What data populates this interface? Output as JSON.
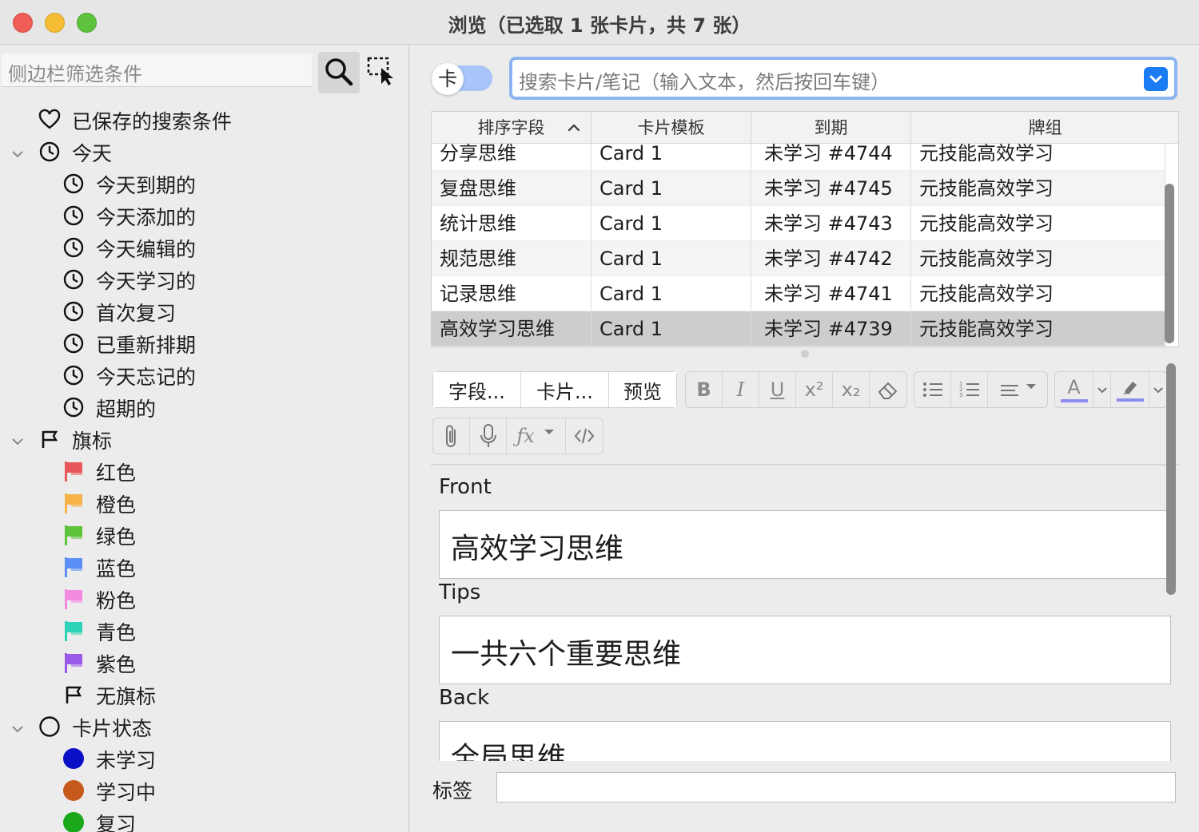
{
  "window": {
    "title": "浏览（已选取 1 张卡片，共 7 张）"
  },
  "sidebar": {
    "filter_placeholder": "侧边栏筛选条件",
    "items": [
      {
        "label": "已保存的搜索条件",
        "icon": "heart-icon",
        "level": 0,
        "expandable": false
      },
      {
        "label": "今天",
        "icon": "clock-icon",
        "level": 0,
        "expandable": true
      },
      {
        "label": "今天到期的",
        "icon": "clock-icon",
        "level": 1
      },
      {
        "label": "今天添加的",
        "icon": "clock-icon",
        "level": 1
      },
      {
        "label": "今天编辑的",
        "icon": "clock-icon",
        "level": 1
      },
      {
        "label": "今天学习的",
        "icon": "clock-icon",
        "level": 1
      },
      {
        "label": "首次复习",
        "icon": "clock-icon",
        "level": 1
      },
      {
        "label": "已重新排期",
        "icon": "clock-icon",
        "level": 1
      },
      {
        "label": "今天忘记的",
        "icon": "clock-icon",
        "level": 1
      },
      {
        "label": "超期的",
        "icon": "clock-icon",
        "level": 1
      },
      {
        "label": "旗标",
        "icon": "flag-outline-icon",
        "level": 0,
        "expandable": true
      },
      {
        "label": "红色",
        "icon": "flag-red-icon",
        "level": 1,
        "color": "#e8575a"
      },
      {
        "label": "橙色",
        "icon": "flag-orange-icon",
        "level": 1,
        "color": "#f7b24a"
      },
      {
        "label": "绿色",
        "icon": "flag-green-icon",
        "level": 1,
        "color": "#5ec43c"
      },
      {
        "label": "蓝色",
        "icon": "flag-blue-icon",
        "level": 1,
        "color": "#5b8ff7"
      },
      {
        "label": "粉色",
        "icon": "flag-pink-icon",
        "level": 1,
        "color": "#f48ae0"
      },
      {
        "label": "青色",
        "icon": "flag-cyan-icon",
        "level": 1,
        "color": "#2ed3b7"
      },
      {
        "label": "紫色",
        "icon": "flag-purple-icon",
        "level": 1,
        "color": "#9b59e8"
      },
      {
        "label": "无旗标",
        "icon": "flag-outline-icon",
        "level": 1
      },
      {
        "label": "卡片状态",
        "icon": "circle-outline-icon",
        "level": 0,
        "expandable": true
      },
      {
        "label": "未学习",
        "icon": "dot-new-icon",
        "level": 1,
        "color": "#0a10c8"
      },
      {
        "label": "学习中",
        "icon": "dot-learning-icon",
        "level": 1,
        "color": "#c65a1c"
      },
      {
        "label": "复习",
        "icon": "dot-review-icon",
        "level": 1,
        "color": "#1aa81a"
      }
    ]
  },
  "toggle": {
    "label": "卡"
  },
  "search": {
    "placeholder": "搜索卡片/笔记（输入文本，然后按回车键）"
  },
  "table": {
    "columns": [
      "排序字段",
      "卡片模板",
      "到期",
      "牌组"
    ],
    "rows": [
      {
        "sort": "分享思维",
        "template": "Card 1",
        "due": "未学习 #4744",
        "deck": "元技能高效学习"
      },
      {
        "sort": "复盘思维",
        "template": "Card 1",
        "due": "未学习 #4745",
        "deck": "元技能高效学习"
      },
      {
        "sort": "统计思维",
        "template": "Card 1",
        "due": "未学习 #4743",
        "deck": "元技能高效学习"
      },
      {
        "sort": "规范思维",
        "template": "Card 1",
        "due": "未学习 #4742",
        "deck": "元技能高效学习"
      },
      {
        "sort": "记录思维",
        "template": "Card 1",
        "due": "未学习 #4741",
        "deck": "元技能高效学习"
      },
      {
        "sort": "高效学习思维",
        "template": "Card 1",
        "due": "未学习 #4739",
        "deck": "元技能高效学习"
      }
    ],
    "selected_row": 5
  },
  "editor": {
    "fields_btn": "字段...",
    "cards_btn": "卡片...",
    "preview_btn": "预览",
    "fields": [
      {
        "name": "Front",
        "value": "高效学习思维"
      },
      {
        "name": "Tips",
        "value": "一共六个重要思维"
      },
      {
        "name": "Back",
        "value": "全局思维"
      }
    ],
    "tags_label": "标签",
    "text_color": "#8c8cf0",
    "highlight_color": "#8c8cf0"
  }
}
